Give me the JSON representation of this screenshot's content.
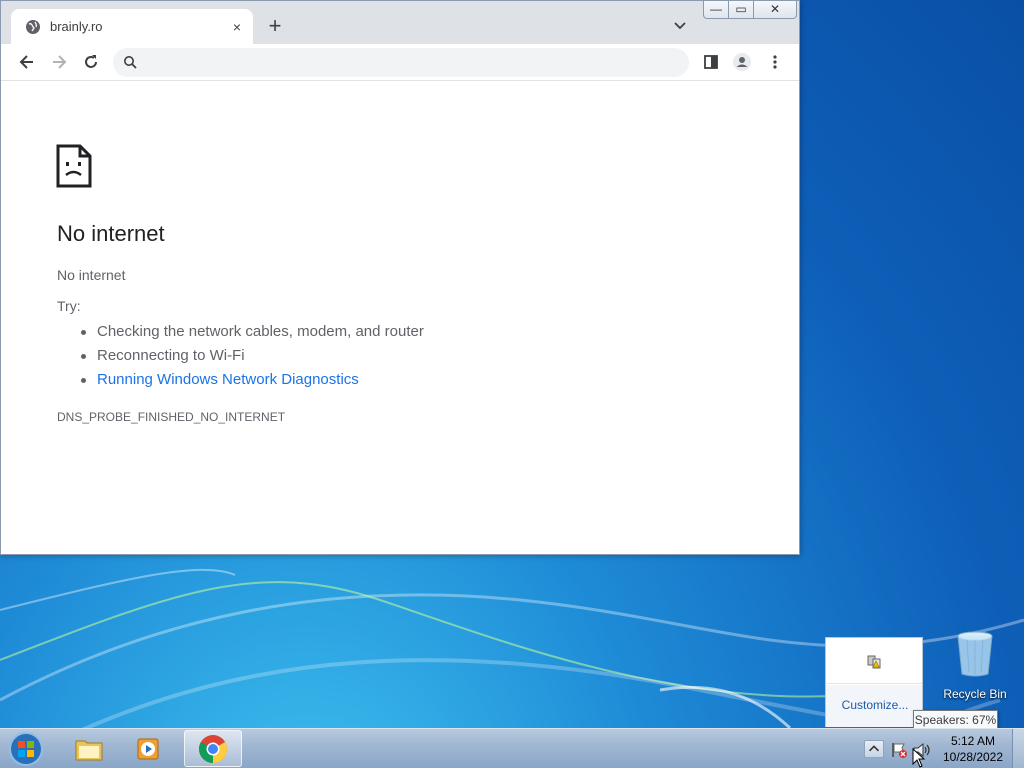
{
  "browser": {
    "tab_title": "brainly.ro",
    "tab_close": "×",
    "new_tab": "+",
    "omnibox_value": "",
    "window_controls": {
      "minimize": "—",
      "maximize": "▭",
      "close": "✕"
    }
  },
  "error_page": {
    "title": "No internet",
    "subtitle": "No internet",
    "try_label": "Try:",
    "suggestions": [
      "Checking the network cables, modem, and router",
      "Reconnecting to Wi-Fi",
      "Running Windows Network Diagnostics"
    ],
    "error_code": "DNS_PROBE_FINISHED_NO_INTERNET"
  },
  "tray_panel": {
    "customize_label": "Customize..."
  },
  "desktop": {
    "recycle_bin_label": "Recycle Bin"
  },
  "tooltip": {
    "text": "Speakers: 67%"
  },
  "taskbar": {
    "clock_time": "5:12 AM",
    "clock_date": "10/28/2022"
  },
  "colors": {
    "accent": "#1a73e8",
    "tab_strip": "#dee1e6"
  }
}
